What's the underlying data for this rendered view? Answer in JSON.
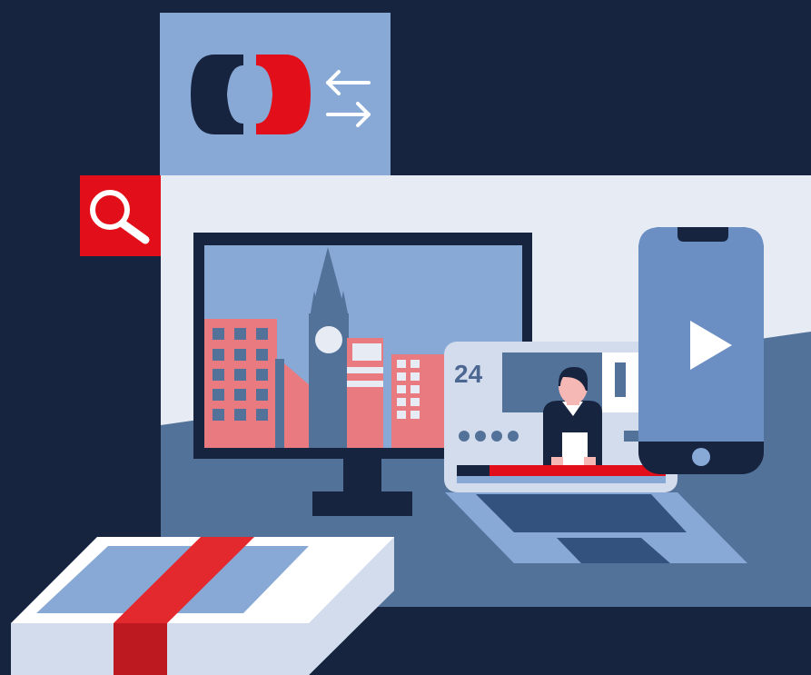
{
  "colors": {
    "navy": "#17243f",
    "light_blue": "#88a9d6",
    "mid_blue": "#52729a",
    "deep_blue": "#34527e",
    "pale": "#e6ebf4",
    "red": "#e20f1a",
    "salmon": "#e97a80",
    "white": "#ffffff"
  },
  "icons": {
    "brand": "ct-logo-icon",
    "swap": "swap-arrows-icon",
    "search": "search-icon",
    "play": "play-icon"
  },
  "laptop": {
    "channel_label": "24"
  }
}
